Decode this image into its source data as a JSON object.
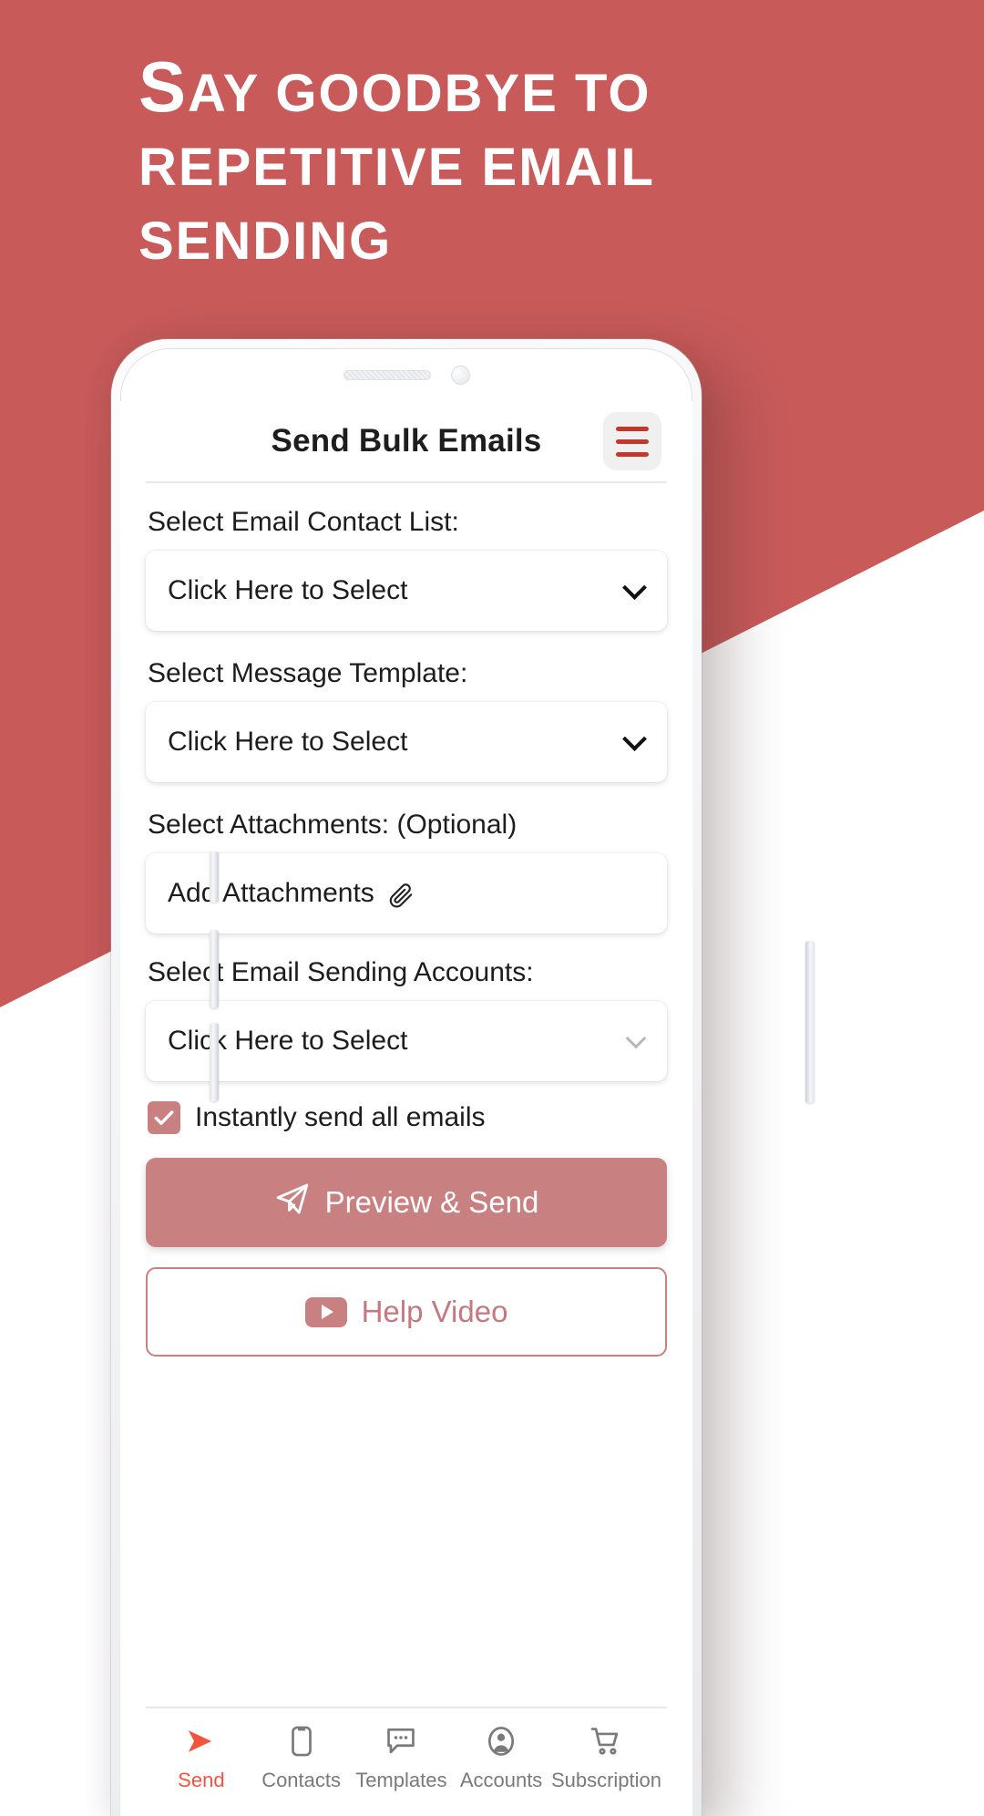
{
  "promo": {
    "headline": "Say goodbye to repetitive email sending",
    "headline_first_letter": "S",
    "headline_rest": "ay goodbye to repetitive email sending",
    "background_color": "#c85a5a",
    "text_color": "#ffffff"
  },
  "app": {
    "title": "Send Bulk Emails",
    "menu_icon": "hamburger-icon",
    "accent_color": "#c98080",
    "menu_bar_color": "#c0392b"
  },
  "form": {
    "contacts": {
      "label": "Select Email Contact List:",
      "value": "Click Here to Select",
      "chevron": "chevron-down-icon"
    },
    "templates": {
      "label": "Select Message Template:",
      "value": "Click Here to Select",
      "chevron": "chevron-down-icon"
    },
    "attachments": {
      "label": "Select Attachments: (Optional)",
      "value": "Add Attachments",
      "icon": "paperclip-icon",
      "icon_glyph": "✐"
    },
    "accounts": {
      "label": "Select Email Sending Accounts:",
      "value": "Click Here to Select",
      "chevron": "chevron-down-icon"
    },
    "instant_send": {
      "label": "Instantly send all emails",
      "checked": true,
      "checkbox_color": "#c98080"
    }
  },
  "actions": {
    "primary": {
      "label": "Preview & Send",
      "icon": "paper-plane-icon",
      "background": "#c98080",
      "text_color": "#ffffff"
    },
    "secondary": {
      "label": "Help Video",
      "icon": "play-video-icon",
      "border_color": "#c98080",
      "text_color": "#c4787f"
    }
  },
  "bottom_nav": {
    "items": [
      {
        "label": "Send",
        "icon": "send-arrow-icon",
        "active": true
      },
      {
        "label": "Contacts",
        "icon": "contact-card-icon",
        "active": false
      },
      {
        "label": "Templates",
        "icon": "chat-bubble-icon",
        "active": false
      },
      {
        "label": "Accounts",
        "icon": "user-circle-icon",
        "active": false
      },
      {
        "label": "Subscription",
        "icon": "shopping-cart-icon",
        "active": false
      }
    ],
    "active_color": "#f4543c",
    "inactive_color": "#7a7a7a"
  },
  "device": {
    "speaker": "speaker-grille",
    "camera": "front-camera"
  }
}
